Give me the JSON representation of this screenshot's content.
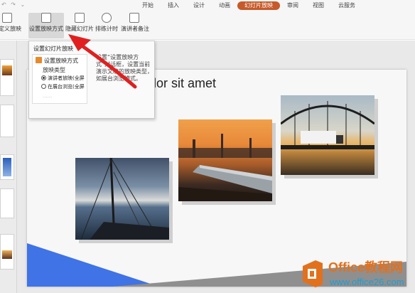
{
  "menubar": {
    "tabs": [
      {
        "label": "开始"
      },
      {
        "label": "插入"
      },
      {
        "label": "设计"
      },
      {
        "label": "动画"
      },
      {
        "label": "幻灯片放映"
      },
      {
        "label": "审阅"
      },
      {
        "label": "视图"
      },
      {
        "label": "云服务"
      }
    ],
    "active_tab": "幻灯片放映"
  },
  "ribbon": {
    "custom_show": "自定义放映",
    "setup_show": "设置放映方式",
    "hide_slide": "隐藏幻灯片",
    "rehearse_timings": "排练计时",
    "presenter_notes": "演讲者备注"
  },
  "dropdown": {
    "header": "设置幻灯片放映",
    "item_title": "设置放映方式",
    "show_type_label": "放映类型",
    "option_presenter": "演讲者放映(全屏",
    "option_kiosk": "在展台浏览(全屏",
    "more": "······",
    "description": "设置“设置放映方式”对话框，设置当前演示文稿的放映类型，如展台浏览模式。"
  },
  "slide": {
    "title": "lor sit amet"
  },
  "watermark": {
    "brand": "Office教程网",
    "url": "www.office26.com"
  },
  "colors": {
    "active_tab": "#c65a2a",
    "arrow": "#e02020",
    "accent_blue": "#3f73e6",
    "accent_gray": "#8f8f8f",
    "watermark_orange": "#e2711d",
    "watermark_blue": "#1a9fd8"
  }
}
